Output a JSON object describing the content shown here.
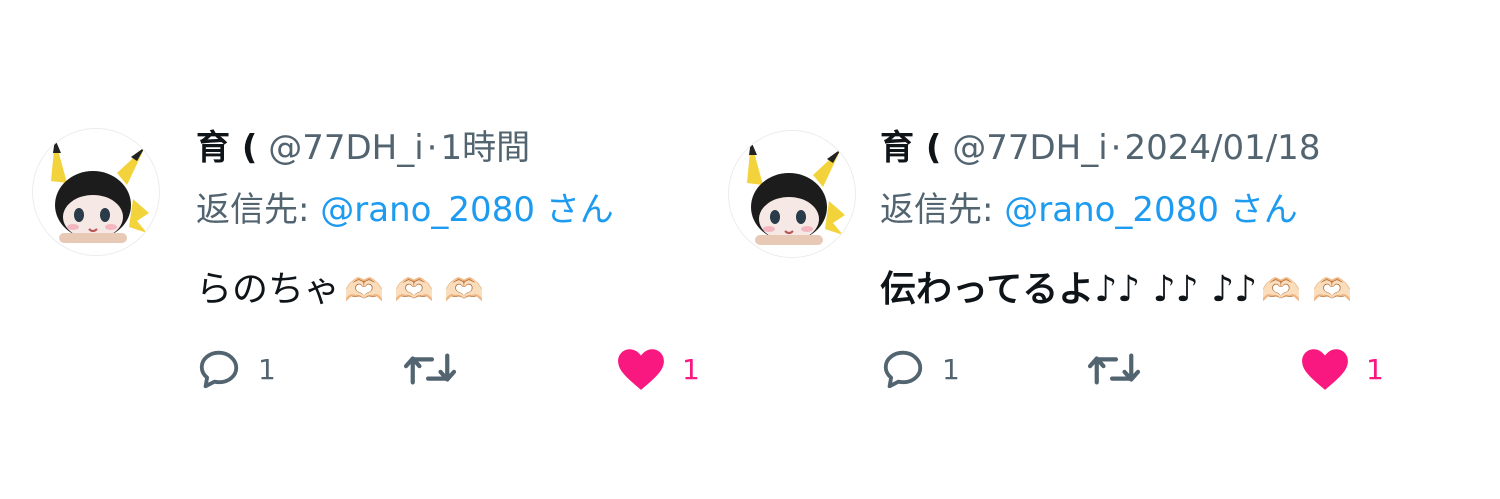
{
  "colors": {
    "accent": "#1d9bf0",
    "like": "#f91880",
    "muted": "#536471",
    "text": "#0f1419"
  },
  "tweets": [
    {
      "display_name": "育 (",
      "handle": "@77DH_i",
      "separator": "·",
      "time": "1時間",
      "reply_prefix": "返信先: ",
      "reply_mention": "@rano_2080",
      "reply_suffix": " さん",
      "body": "らのちゃ",
      "emoji": "🫶🏻 🫶🏻 🫶🏻",
      "reply_count": "1",
      "like_count": "1",
      "liked": true,
      "icons": {
        "avatar": "avatar-icon",
        "reply": "reply-icon",
        "retweet": "retweet-icon",
        "like": "heart-icon"
      }
    },
    {
      "display_name": "育 (",
      "handle": "@77DH_i",
      "separator": "·",
      "time": "2024/01/18",
      "reply_prefix": "返信先: ",
      "reply_mention": "@rano_2080",
      "reply_suffix": " さん",
      "body": "伝わってるよ♪♪ ♪♪ ♪♪",
      "emoji": "🫶🏻 🫶🏻",
      "reply_count": "1",
      "like_count": "1",
      "liked": true,
      "icons": {
        "avatar": "avatar-icon",
        "reply": "reply-icon",
        "retweet": "retweet-icon",
        "like": "heart-icon"
      }
    }
  ]
}
